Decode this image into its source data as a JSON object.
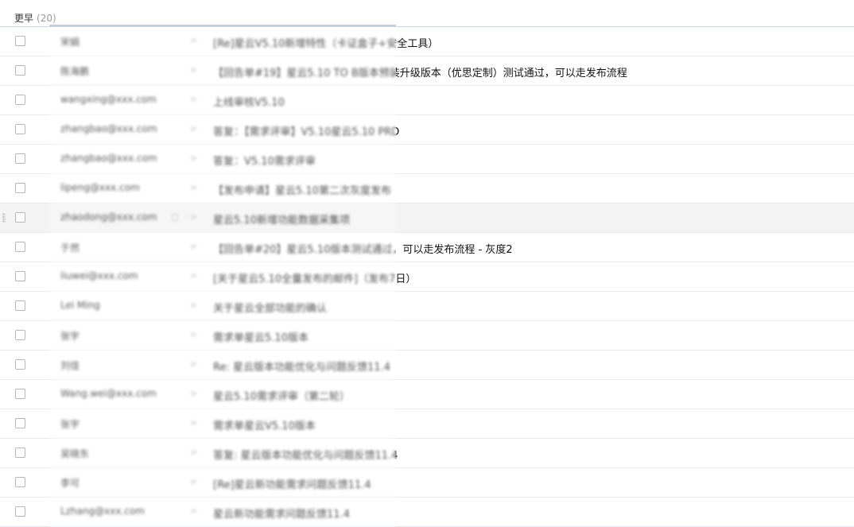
{
  "group": {
    "label": "更早",
    "count": "(20)"
  },
  "rows": [
    {
      "sender": "宋娟",
      "subject": "[Re]星云V5.10新增特性（卡证盒子+安全工具）"
    },
    {
      "sender": "陈海鹏",
      "subject": "【回告单#19】星云5.10 TO B版本预装升级版本（优思定制）测试通过，可以走发布流程"
    },
    {
      "sender": "wangxing@xxx.com",
      "subject": "上线审核V5.10"
    },
    {
      "sender": "zhangbao@xxx.com",
      "subject": "答复：【需求评审】V5.10星云5.10 PRD"
    },
    {
      "sender": "zhangbao@xxx.com",
      "subject": "答复：V5.10需求评审"
    },
    {
      "sender": "lipeng@xxx.com",
      "subject": "【发布申请】星云5.10第二次灰度发布"
    },
    {
      "sender": "zhaodong@xxx.com",
      "subject": "星云5.10新增功能数据采集项"
    },
    {
      "sender": "于然",
      "subject": "【回告单#20】星云5.10版本测试通过，可以走发布流程 - 灰度2"
    },
    {
      "sender": "liuwei@xxx.com",
      "subject": "[关于星云5.10全量发布的邮件]（发布7日）"
    },
    {
      "sender": "Lei Ming",
      "subject": "关于星云全部功能的确认"
    },
    {
      "sender": "张宇",
      "subject": "需求单星云5.10版本"
    },
    {
      "sender": "刘佳",
      "subject": "Re: 星云版本功能优化与问题反馈11.4"
    },
    {
      "sender": "Wang.wei@xxx.com",
      "subject": "星云5.10需求评审（第二轮）"
    },
    {
      "sender": "张宇",
      "subject": "需求单星云V5.10版本"
    },
    {
      "sender": "吴晓东",
      "subject": "答复: 星云版本功能优化与问题反馈11.4"
    },
    {
      "sender": "李可",
      "subject": "[Re]星云新功能需求问题反馈11.4"
    },
    {
      "sender": "Lzhang@xxx.com",
      "subject": "星云新功能需求问题反馈11.4"
    }
  ],
  "hover_row_index": 6,
  "icons": {
    "checkbox": "checkbox-icon",
    "flag": "flag-icon",
    "note": "note-icon",
    "drag": "drag-handle-icon"
  },
  "colors": {
    "separator": "#e6e9ee",
    "hover": "#f3f3f3",
    "header_line": "#c9d6e4"
  }
}
